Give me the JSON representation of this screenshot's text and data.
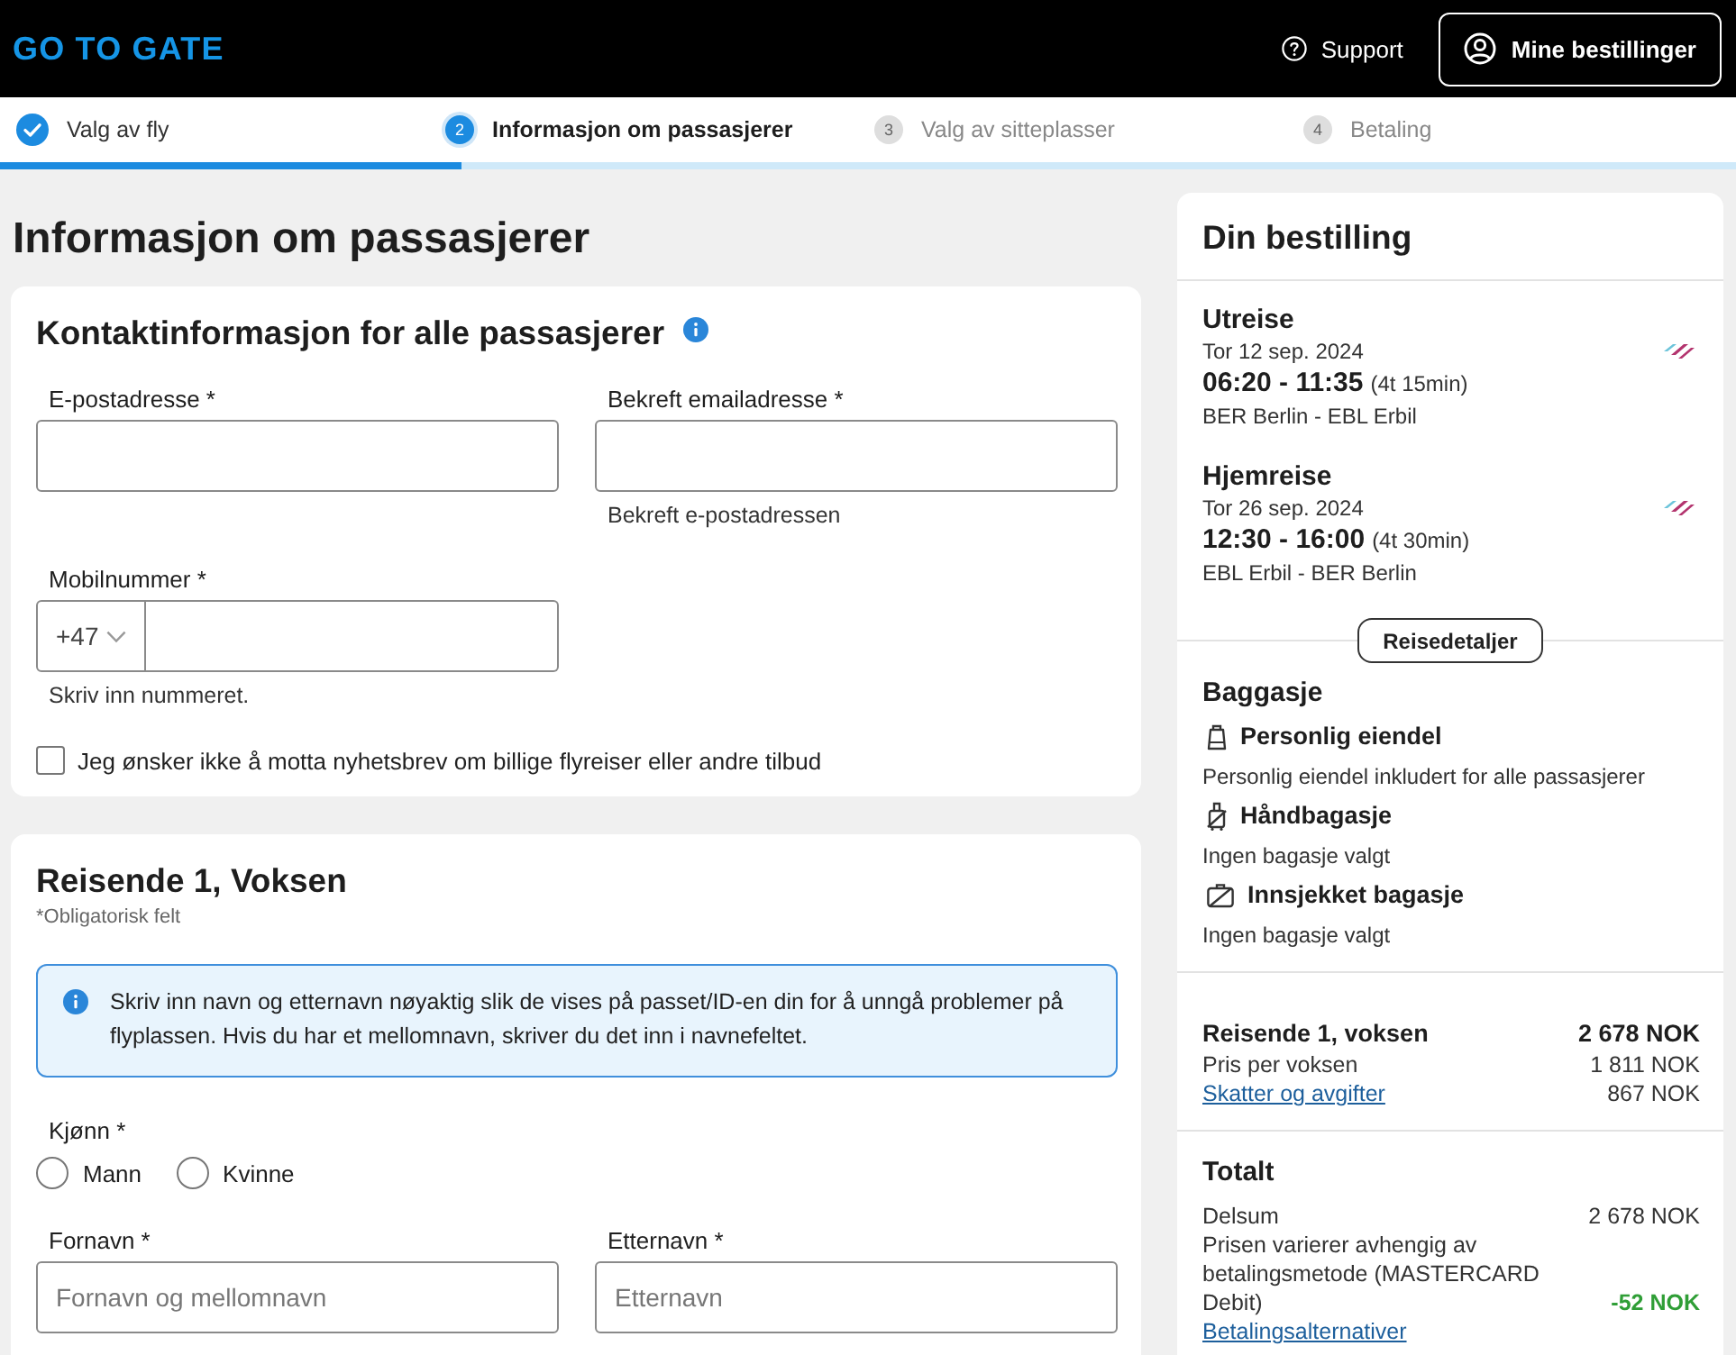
{
  "header": {
    "logo": "GO TO GATE",
    "support": "Support",
    "account_button": "Mine bestillinger"
  },
  "progress": {
    "level": 0.266,
    "steps": [
      {
        "label": "Valg av fly",
        "completed": true,
        "selected": false
      },
      {
        "number": "2",
        "label": "Informasjon om passasjerer",
        "completed": false,
        "selected": true
      },
      {
        "number": "3",
        "label": "Valg av sitteplasser",
        "completed": false,
        "selected": false
      },
      {
        "number": "4",
        "label": "Betaling",
        "completed": false,
        "selected": false
      }
    ]
  },
  "page_title": "Informasjon om passasjerer",
  "contact": {
    "title": "Kontaktinformasjon for alle passasjerer",
    "fields": [
      {
        "label": "E-postadresse *"
      },
      {
        "label": "Bekreft emailadresse *",
        "helper": "Bekreft e-postadressen"
      }
    ],
    "phone": {
      "label": "Mobilnummer *",
      "prefix": "+47",
      "helper": "Skriv inn nummeret."
    },
    "newsletter": {
      "label": "Jeg ønsker ikke å motta nyhetsbrev om billige flyreiser eller andre tilbud",
      "checked": false
    }
  },
  "traveler": {
    "title": "Reisende 1, Voksen",
    "note": "*Obligatorisk felt",
    "info": "Skriv inn navn og etternavn nøyaktig slik de vises på passet/ID-en din for å unngå problemer på flyplassen. Hvis du har et mellomnavn, skriver du det inn i navnefeltet.",
    "gender": {
      "label": "Kjønn *",
      "options": [
        {
          "label": "Mann",
          "selected": false
        },
        {
          "label": "Kvinne",
          "selected": false
        }
      ]
    },
    "fields": [
      {
        "label": "Fornavn *",
        "placeholder": "Fornavn og mellomnavn"
      },
      {
        "label": "Etternavn *",
        "placeholder": "Etternavn"
      }
    ]
  },
  "summary": {
    "title": "Din bestilling",
    "legs": [
      {
        "title": "Utreise",
        "date": "Tor 12 sep. 2024",
        "times": "06:20 - 11:35",
        "duration": "(4t 15min)",
        "route": "BER Berlin - EBL Erbil"
      },
      {
        "title": "Hjemreise",
        "date": "Tor 26 sep. 2024",
        "times": "12:30 - 16:00",
        "duration": "(4t 30min)",
        "route": "EBL Erbil - BER Berlin"
      }
    ],
    "details_button": "Reisedetaljer",
    "baggage": {
      "title": "Baggasje",
      "items": [
        {
          "kind": "personal",
          "included": true,
          "name": "Personlig eiendel",
          "note": "Personlig eiendel inkludert for alle passasjerer"
        },
        {
          "kind": "cabin",
          "included": false,
          "name": "Håndbagasje",
          "note": "Ingen bagasje valgt"
        },
        {
          "kind": "checked",
          "included": false,
          "name": "Innsjekket bagasje",
          "note": "Ingen bagasje valgt"
        }
      ]
    },
    "price": {
      "title": "Reisende 1, voksen",
      "total": "2 678 NOK",
      "lines": [
        {
          "kind": "text",
          "label": "Pris per voksen",
          "amount": "1 811 NOK"
        },
        {
          "kind": "link",
          "label": "Skatter og avgifter",
          "amount": "867 NOK"
        }
      ]
    },
    "totals": {
      "title": "Totalt",
      "lines": [
        {
          "kind": "normal",
          "label": "Delsum",
          "amount": "2 678 NOK"
        },
        {
          "kind": "discount",
          "label": "Prisen varierer avhengig av betalingsmetode (MASTERCARD Debit)",
          "amount": "-52 NOK"
        }
      ],
      "link": "Betalingsalternativer"
    }
  }
}
